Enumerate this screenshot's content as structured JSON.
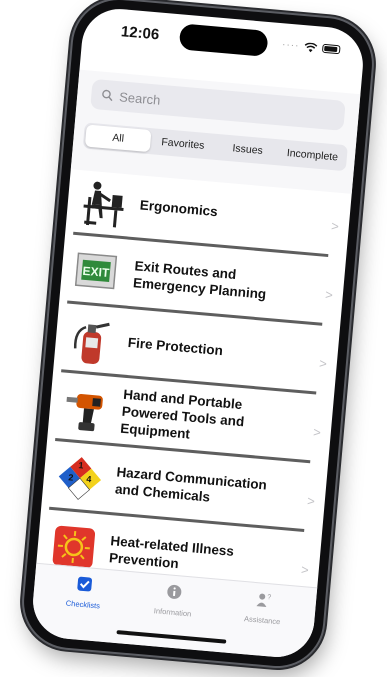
{
  "status_bar": {
    "time": "12:06"
  },
  "search": {
    "placeholder": "Search"
  },
  "filters": [
    "All",
    "Favorites",
    "Issues",
    "Incomplete"
  ],
  "selected_filter": "All",
  "checklist": [
    {
      "label": "Ergonomics",
      "icon": "ergonomics-icon"
    },
    {
      "label": "Exit Routes and Emergency Planning",
      "icon": "exit-sign-icon"
    },
    {
      "label": "Fire Protection",
      "icon": "fire-extinguisher-icon"
    },
    {
      "label": "Hand and Portable Powered Tools and Equipment",
      "icon": "power-drill-icon"
    },
    {
      "label": "Hazard Communication and Chemicals",
      "icon": "nfpa-diamond-icon"
    },
    {
      "label": "Heat-related Illness Prevention",
      "icon": "sun-icon"
    }
  ],
  "tabs": [
    {
      "label": "Checklists",
      "icon": "checkbox-icon",
      "active": true
    },
    {
      "label": "Information",
      "icon": "info-icon",
      "active": false
    },
    {
      "label": "Assistance",
      "icon": "person-question-icon",
      "active": false
    }
  ],
  "colors": {
    "accent": "#1a5bd8",
    "row_line": "#5e5e5e",
    "exit_green": "#2f8a3a",
    "extinguisher_red": "#c0392b"
  }
}
